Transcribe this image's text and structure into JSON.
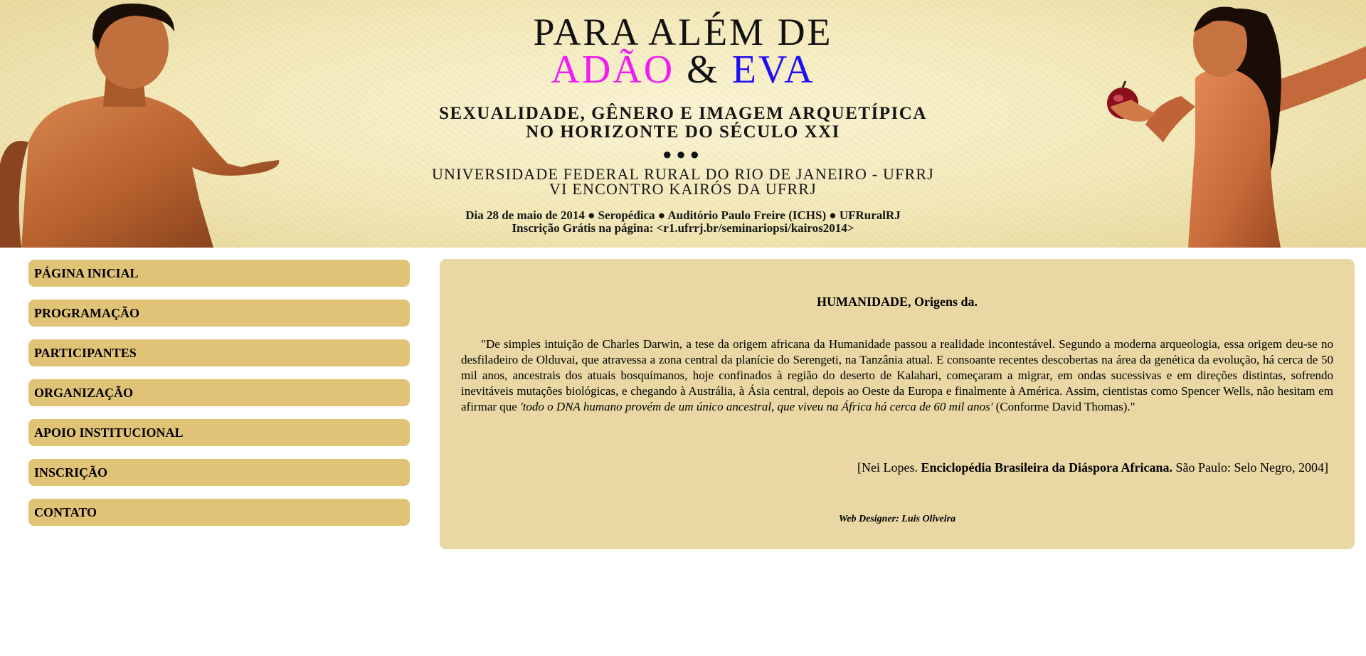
{
  "banner": {
    "title_line1": "PARA ALÉM DE",
    "title_adao": "ADÃO",
    "title_amp": "&",
    "title_eva": "EVA",
    "subtitle_line1": "SEXUALIDADE, GÊNERO E IMAGEM ARQUETÍPICA",
    "subtitle_line2": "NO HORIZONTE DO SÉCULO XXI",
    "separator": "●●●",
    "university": "UNIVERSIDADE FEDERAL RURAL DO RIO DE JANEIRO - UFRRJ",
    "event": "VI ENCONTRO KAIRÓS DA UFRRJ",
    "date_line": "Dia 28 de maio de 2014 ● Seropédica ● Auditório Paulo Freire (ICHS) ● UFRuralRJ",
    "registration_line": "Inscrição Grátis na página: <r1.ufrrj.br/seminariopsi/kairos2014>",
    "colors": {
      "adao": "#f21bf0",
      "eva": "#1f0df5",
      "background": "#f6eec6"
    }
  },
  "sidebar": {
    "items": [
      {
        "label": "PÁGINA INICIAL"
      },
      {
        "label": "PROGRAMAÇÃO"
      },
      {
        "label": "PARTICIPANTES"
      },
      {
        "label": "ORGANIZAÇÃO"
      },
      {
        "label": "APOIO INSTITUCIONAL"
      },
      {
        "label": "INSCRIÇÃO"
      },
      {
        "label": "CONTATO"
      }
    ],
    "item_color": "#e0c377"
  },
  "content": {
    "title": "HUMANIDADE, Origens da.",
    "quote_plain": "\"De simples intuição de Charles Darwin, a tese da origem africana da Humanidade passou a realidade incontestável. Segundo a moderna arqueologia, essa origem deu-se no desfiladeiro de Olduvai, que atravessa a zona central da planície do Serengeti, na Tanzânia atual. E consoante recentes descobertas na área da genética da evolução, há cerca de 50 mil anos, ancestrais dos atuais bosquímanos, hoje confinados à região do deserto de Kalahari, começaram a migrar, em ondas sucessivas e em direções distintas, sofrendo inevitáveis mutações biológicas, e chegando à Austrália, à Ásia central, depois ao Oeste da Europa e finalmente à América. Assim, cientistas como Spencer Wells, não hesitam em afirmar que ",
    "quote_italic": "'todo o DNA humano provém de um único ancestral, que viveu na África há cerca de 60 mil anos'",
    "quote_end": " (Conforme David Thomas).\"",
    "cite_open": "[Nei Lopes. ",
    "cite_book": "Enciclopédia Brasileira da Diáspora Africana.",
    "cite_rest": " São Paulo: Selo Negro, 2004]",
    "credit": "Web Designer: Luis Oliveira",
    "background_color": "#e9d7a4"
  }
}
